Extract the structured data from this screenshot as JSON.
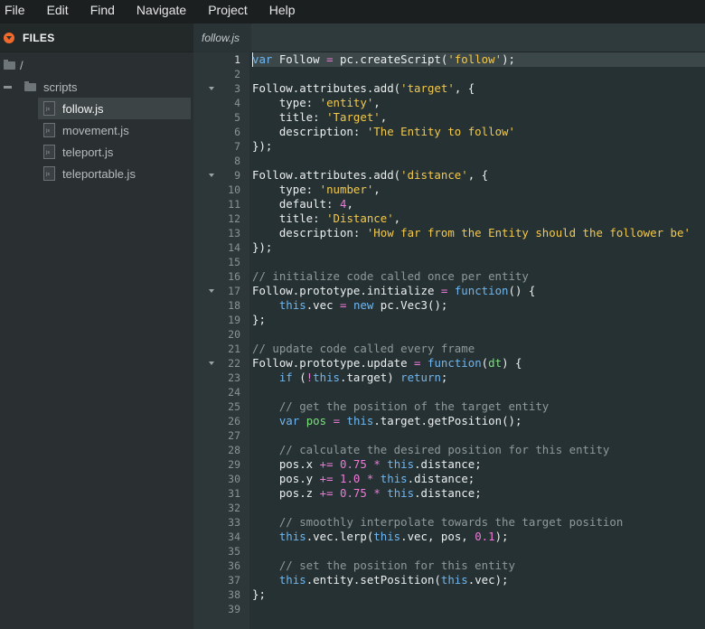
{
  "menu": [
    "File",
    "Edit",
    "Find",
    "Navigate",
    "Project",
    "Help"
  ],
  "sidebar": {
    "title": "FILES",
    "root": "/",
    "folder": "scripts",
    "files": [
      "follow.js",
      "movement.js",
      "teleport.js",
      "teleportable.js"
    ],
    "selected_file": "follow.js"
  },
  "editor": {
    "tab_label": "follow.js",
    "active_line": 1,
    "fold_lines": [
      3,
      9,
      17,
      22
    ],
    "lines": [
      [
        [
          "kw",
          "var"
        ],
        [
          "idf",
          " Follow "
        ],
        [
          "op",
          "="
        ],
        [
          "idf",
          " pc.createScript("
        ],
        [
          "str",
          "'follow'"
        ],
        [
          "idf",
          ");"
        ]
      ],
      [],
      [
        [
          "idf",
          "Follow.attributes.add("
        ],
        [
          "str",
          "'target'"
        ],
        [
          "idf",
          ", {"
        ]
      ],
      [
        [
          "idf",
          "    type: "
        ],
        [
          "str",
          "'entity'"
        ],
        [
          "idf",
          ","
        ]
      ],
      [
        [
          "idf",
          "    title: "
        ],
        [
          "str",
          "'Target'"
        ],
        [
          "idf",
          ","
        ]
      ],
      [
        [
          "idf",
          "    description: "
        ],
        [
          "str",
          "'The Entity to follow'"
        ]
      ],
      [
        [
          "idf",
          "});"
        ]
      ],
      [],
      [
        [
          "idf",
          "Follow.attributes.add("
        ],
        [
          "str",
          "'distance'"
        ],
        [
          "idf",
          ", {"
        ]
      ],
      [
        [
          "idf",
          "    type: "
        ],
        [
          "str",
          "'number'"
        ],
        [
          "idf",
          ","
        ]
      ],
      [
        [
          "idf",
          "    default: "
        ],
        [
          "num",
          "4"
        ],
        [
          "idf",
          ","
        ]
      ],
      [
        [
          "idf",
          "    title: "
        ],
        [
          "str",
          "'Distance'"
        ],
        [
          "idf",
          ","
        ]
      ],
      [
        [
          "idf",
          "    description: "
        ],
        [
          "str",
          "'How far from the Entity should the follower be'"
        ]
      ],
      [
        [
          "idf",
          "});"
        ]
      ],
      [],
      [
        [
          "cm",
          "// initialize code called once per entity"
        ]
      ],
      [
        [
          "idf",
          "Follow.prototype.initialize "
        ],
        [
          "op",
          "="
        ],
        [
          "idf",
          " "
        ],
        [
          "fn",
          "function"
        ],
        [
          "idf",
          "() {"
        ]
      ],
      [
        [
          "idf",
          "    "
        ],
        [
          "kw",
          "this"
        ],
        [
          "idf",
          ".vec "
        ],
        [
          "op",
          "="
        ],
        [
          "idf",
          " "
        ],
        [
          "kw",
          "new"
        ],
        [
          "idf",
          " pc.Vec3();"
        ]
      ],
      [
        [
          "idf",
          "};"
        ]
      ],
      [],
      [
        [
          "cm",
          "// update code called every frame"
        ]
      ],
      [
        [
          "idf",
          "Follow.prototype.update "
        ],
        [
          "op",
          "="
        ],
        [
          "idf",
          " "
        ],
        [
          "fn",
          "function"
        ],
        [
          "idf",
          "("
        ],
        [
          "param",
          "dt"
        ],
        [
          "idf",
          ") {"
        ]
      ],
      [
        [
          "idf",
          "    "
        ],
        [
          "kw",
          "if"
        ],
        [
          "idf",
          " ("
        ],
        [
          "op",
          "!"
        ],
        [
          "kw",
          "this"
        ],
        [
          "idf",
          ".target) "
        ],
        [
          "kw",
          "return"
        ],
        [
          "idf",
          ";"
        ]
      ],
      [],
      [
        [
          "idf",
          "    "
        ],
        [
          "cm",
          "// get the position of the target entity"
        ]
      ],
      [
        [
          "idf",
          "    "
        ],
        [
          "kw",
          "var"
        ],
        [
          "idf",
          " "
        ],
        [
          "param",
          "pos"
        ],
        [
          "idf",
          " "
        ],
        [
          "op",
          "="
        ],
        [
          "idf",
          " "
        ],
        [
          "kw",
          "this"
        ],
        [
          "idf",
          ".target.getPosition();"
        ]
      ],
      [],
      [
        [
          "idf",
          "    "
        ],
        [
          "cm",
          "// calculate the desired position for this entity"
        ]
      ],
      [
        [
          "idf",
          "    pos.x "
        ],
        [
          "op",
          "+="
        ],
        [
          "idf",
          " "
        ],
        [
          "num",
          "0.75"
        ],
        [
          "idf",
          " "
        ],
        [
          "op",
          "*"
        ],
        [
          "idf",
          " "
        ],
        [
          "kw",
          "this"
        ],
        [
          "idf",
          ".distance;"
        ]
      ],
      [
        [
          "idf",
          "    pos.y "
        ],
        [
          "op",
          "+="
        ],
        [
          "idf",
          " "
        ],
        [
          "num",
          "1.0"
        ],
        [
          "idf",
          " "
        ],
        [
          "op",
          "*"
        ],
        [
          "idf",
          " "
        ],
        [
          "kw",
          "this"
        ],
        [
          "idf",
          ".distance;"
        ]
      ],
      [
        [
          "idf",
          "    pos.z "
        ],
        [
          "op",
          "+="
        ],
        [
          "idf",
          " "
        ],
        [
          "num",
          "0.75"
        ],
        [
          "idf",
          " "
        ],
        [
          "op",
          "*"
        ],
        [
          "idf",
          " "
        ],
        [
          "kw",
          "this"
        ],
        [
          "idf",
          ".distance;"
        ]
      ],
      [],
      [
        [
          "idf",
          "    "
        ],
        [
          "cm",
          "// smoothly interpolate towards the target position"
        ]
      ],
      [
        [
          "idf",
          "    "
        ],
        [
          "kw",
          "this"
        ],
        [
          "idf",
          ".vec.lerp("
        ],
        [
          "kw",
          "this"
        ],
        [
          "idf",
          ".vec, pos, "
        ],
        [
          "num",
          "0.1"
        ],
        [
          "idf",
          ");"
        ]
      ],
      [],
      [
        [
          "idf",
          "    "
        ],
        [
          "cm",
          "// set the position for this entity"
        ]
      ],
      [
        [
          "idf",
          "    "
        ],
        [
          "kw",
          "this"
        ],
        [
          "idf",
          ".entity.setPosition("
        ],
        [
          "kw",
          "this"
        ],
        [
          "idf",
          ".vec);"
        ]
      ],
      [
        [
          "idf",
          "};"
        ]
      ],
      []
    ]
  }
}
